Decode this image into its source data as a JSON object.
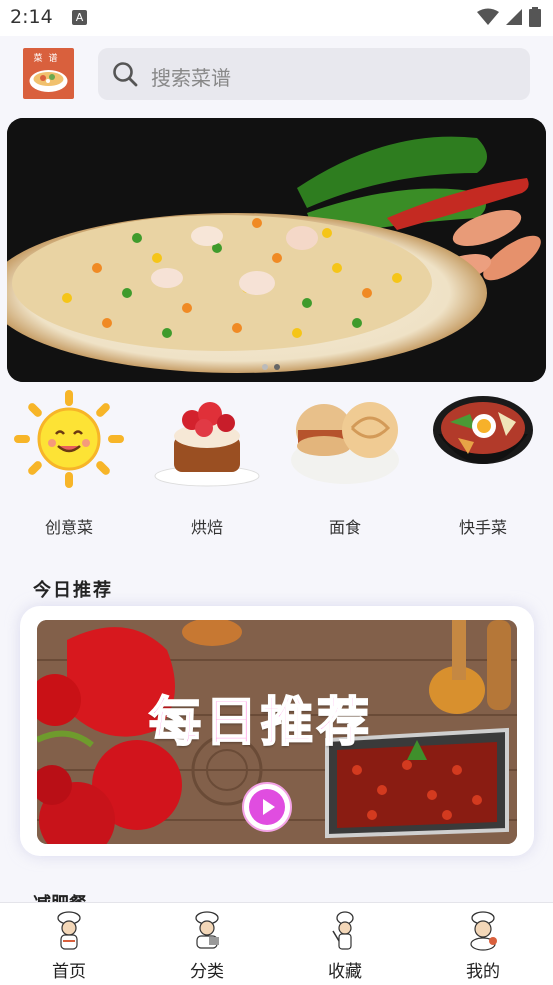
{
  "status_bar": {
    "time": "2:14",
    "notification_icon": "A"
  },
  "header": {
    "logo_text": "菜谱",
    "search_placeholder": "搜索菜谱"
  },
  "banner": {
    "image": "fried-rice-with-shrimp-and-peppers",
    "page_count": 2,
    "active_page": 1
  },
  "categories": [
    {
      "label": "创意菜",
      "icon": "sun-face-icon"
    },
    {
      "label": "烘焙",
      "icon": "strawberry-cake-icon"
    },
    {
      "label": "面食",
      "icon": "meat-bun-icon"
    },
    {
      "label": "快手菜",
      "icon": "bibimbap-bowl-icon"
    }
  ],
  "recommend": {
    "section_title": "今日推荐",
    "banner_title": "每日推荐"
  },
  "next_section_title": "减肥餐",
  "bottom_nav": [
    {
      "label": "首页",
      "icon": "chef-home-icon"
    },
    {
      "label": "分类",
      "icon": "chef-category-icon"
    },
    {
      "label": "收藏",
      "icon": "chef-favorite-icon"
    },
    {
      "label": "我的",
      "icon": "chef-profile-icon"
    }
  ],
  "colors": {
    "title_pink": "#ff6ad6",
    "logo_orange": "#d9603d",
    "play_magenta": "#e04de0"
  }
}
